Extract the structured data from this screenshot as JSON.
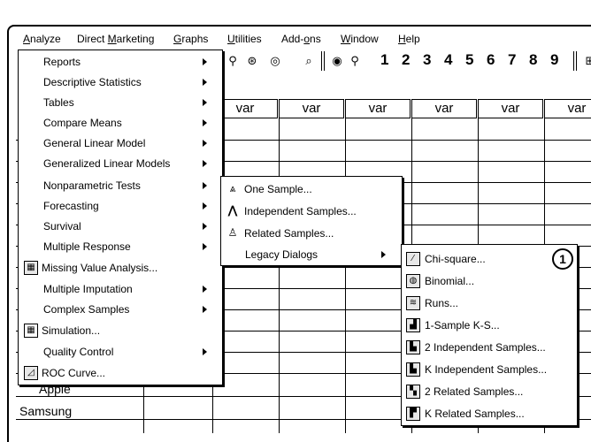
{
  "menubar": {
    "items": [
      {
        "label": "Analyze",
        "ul": "A"
      },
      {
        "label": "Direct Marketing",
        "ul": "M"
      },
      {
        "label": "Graphs",
        "ul": "G"
      },
      {
        "label": "Utilities",
        "ul": "U"
      },
      {
        "label": "Add-ons",
        "ul": "o"
      },
      {
        "label": "Window",
        "ul": "W"
      },
      {
        "label": "Help",
        "ul": "H"
      }
    ]
  },
  "toolbar": {
    "digits": [
      "1",
      "2",
      "3",
      "4",
      "5",
      "6",
      "7",
      "8",
      "9"
    ]
  },
  "grid": {
    "column_header": "var",
    "row_labels": [
      "Apple",
      "Samsung"
    ]
  },
  "analyze_menu": {
    "items": [
      {
        "label": "Reports",
        "submenu": true
      },
      {
        "label": "Descriptive Statistics",
        "submenu": true
      },
      {
        "label": "Tables",
        "submenu": true
      },
      {
        "label": "Compare Means",
        "submenu": true
      },
      {
        "label": "General Linear Model",
        "submenu": true
      },
      {
        "label": "Generalized Linear Models",
        "submenu": true
      },
      {
        "label": "Nonparametric Tests",
        "submenu": true
      },
      {
        "label": "Forecasting",
        "submenu": true
      },
      {
        "label": "Survival",
        "submenu": true
      },
      {
        "label": "Multiple Response",
        "submenu": true
      },
      {
        "label": "Missing Value Analysis...",
        "submenu": false,
        "icon": "missing-values-icon"
      },
      {
        "label": "Multiple Imputation",
        "submenu": true
      },
      {
        "label": "Complex Samples",
        "submenu": true
      },
      {
        "label": "Simulation...",
        "submenu": false,
        "icon": "simulation-grid-icon"
      },
      {
        "label": "Quality Control",
        "submenu": true
      },
      {
        "label": "ROC Curve...",
        "submenu": false,
        "icon": "roc-curve-icon"
      }
    ]
  },
  "nonparametric_menu": {
    "items": [
      {
        "label": "One Sample...",
        "submenu": false,
        "icon": "one-sample-icon"
      },
      {
        "label": "Independent Samples...",
        "submenu": false,
        "icon": "independent-samples-icon"
      },
      {
        "label": "Related Samples...",
        "submenu": false,
        "icon": "related-samples-icon"
      },
      {
        "label": "Legacy Dialogs",
        "submenu": true
      }
    ]
  },
  "legacy_menu": {
    "badge": "1",
    "items": [
      {
        "label": "Chi-square...",
        "icon": "chi-square-icon"
      },
      {
        "label": "Binomial...",
        "icon": "binomial-icon"
      },
      {
        "label": "Runs...",
        "icon": "runs-icon"
      },
      {
        "label": "1-Sample K-S...",
        "icon": "one-sample-ks-icon"
      },
      {
        "label": "2 Independent Samples...",
        "icon": "two-independent-samples-icon"
      },
      {
        "label": "K Independent Samples...",
        "icon": "k-independent-samples-icon"
      },
      {
        "label": "2 Related Samples...",
        "icon": "two-related-samples-icon"
      },
      {
        "label": "K Related Samples...",
        "icon": "k-related-samples-icon"
      }
    ]
  }
}
